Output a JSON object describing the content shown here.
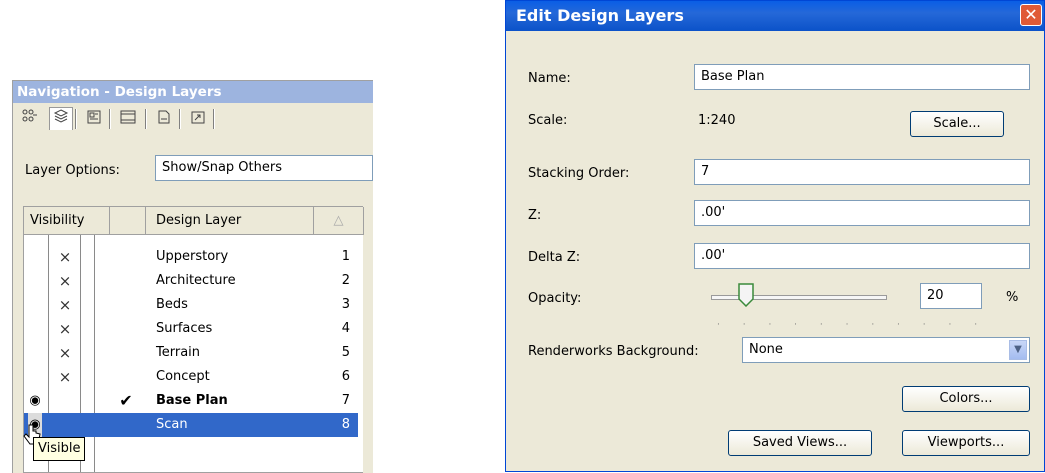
{
  "nav": {
    "title": "Navigation - Design Layers",
    "toolbar_icons": [
      "classes-icon",
      "layers-icon",
      "sheet-layers-icon",
      "viewports-icon",
      "saved-views-icon",
      "references-icon"
    ],
    "layer_options_label": "Layer Options:",
    "layer_options_value": "Show/Snap Others",
    "columns": {
      "visibility": "Visibility",
      "design_layer": "Design Layer",
      "sort": "△"
    },
    "rows": [
      {
        "vis": "×",
        "active": "",
        "name": "Upperstory",
        "num": "1"
      },
      {
        "vis": "×",
        "active": "",
        "name": "Architecture",
        "num": "2"
      },
      {
        "vis": "×",
        "active": "",
        "name": "Beds",
        "num": "3"
      },
      {
        "vis": "×",
        "active": "",
        "name": "Surfaces",
        "num": "4"
      },
      {
        "vis": "×",
        "active": "",
        "name": "Terrain",
        "num": "5"
      },
      {
        "vis": "×",
        "active": "",
        "name": "Concept",
        "num": "6"
      },
      {
        "vis": "◉",
        "active": "✔",
        "name": "Base Plan",
        "num": "7"
      },
      {
        "vis": "◉",
        "active": "",
        "name": "Scan",
        "num": "8"
      }
    ],
    "tooltip": "Visible"
  },
  "dialog": {
    "title": "Edit Design Layers",
    "close_glyph": "✕",
    "name_label": "Name:",
    "name_value": "Base Plan",
    "scale_label": "Scale:",
    "scale_value": "1:240",
    "scale_button": "Scale...",
    "stacking_label": "Stacking Order:",
    "stacking_value": "7",
    "z_label": "Z:",
    "z_value": ".00'",
    "delta_z_label": "Delta Z:",
    "delta_z_value": ".00'",
    "opacity_label": "Opacity:",
    "opacity_value": "20",
    "opacity_unit": "%",
    "opacity_ticks": "· · · · · · · · · · ·",
    "renderworks_label": "Renderworks Background:",
    "renderworks_value": "None",
    "dropdown_glyph": "▼",
    "colors_button": "Colors...",
    "saved_views_button": "Saved Views...",
    "viewports_button": "Viewports..."
  }
}
